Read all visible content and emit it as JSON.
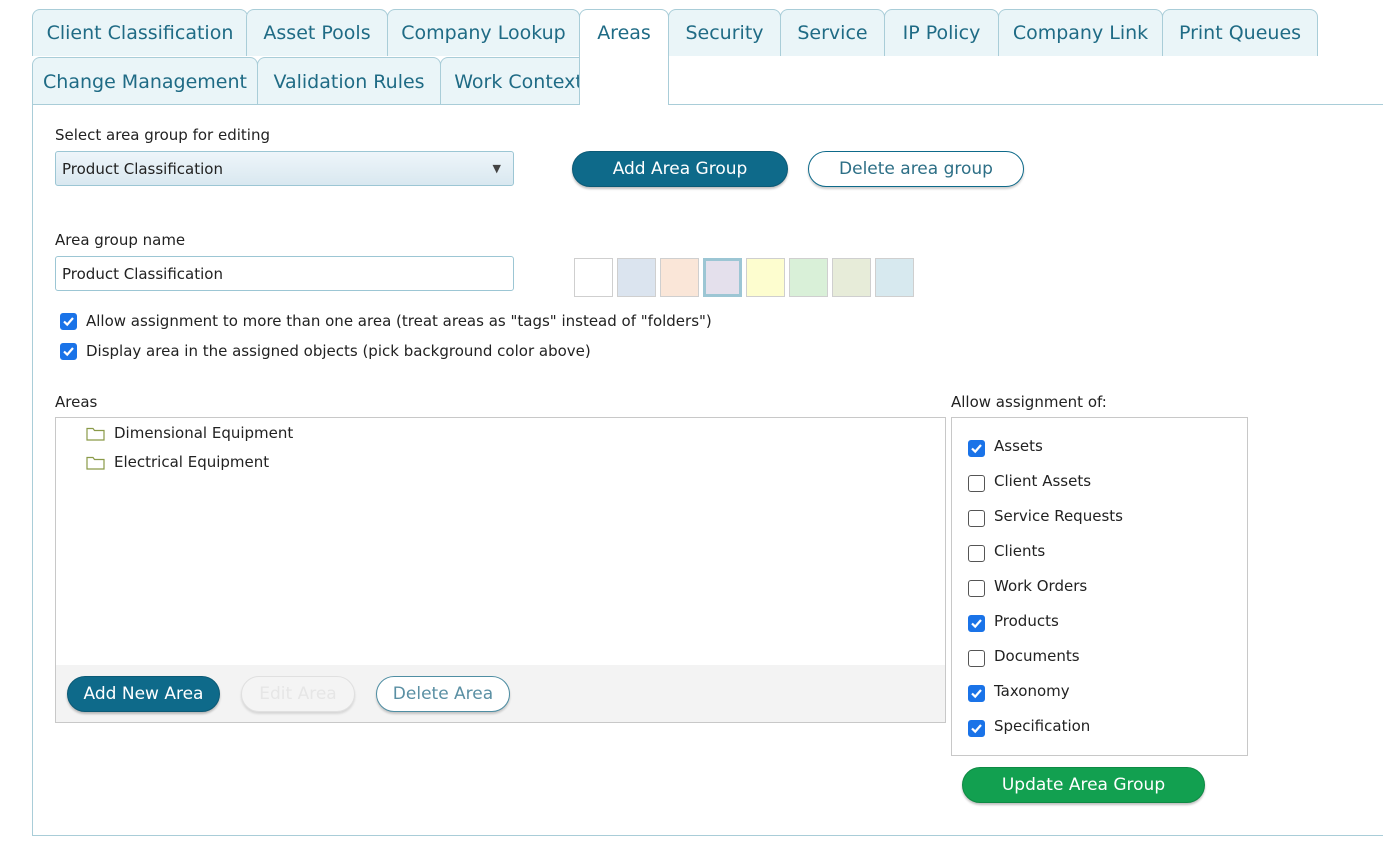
{
  "tabs": {
    "row1": [
      {
        "label": "Client Classification"
      },
      {
        "label": "Asset Pools"
      },
      {
        "label": "Company Lookup"
      },
      {
        "label": "Areas"
      },
      {
        "label": "Security"
      },
      {
        "label": "Service"
      },
      {
        "label": "IP Policy"
      },
      {
        "label": "Company Link"
      },
      {
        "label": "Print Queues"
      }
    ],
    "row2": [
      {
        "label": "Change Management"
      },
      {
        "label": "Validation Rules"
      },
      {
        "label": "Work Contexts"
      }
    ],
    "active": "Areas"
  },
  "group_select": {
    "label": "Select area group for editing",
    "value": "Product Classification"
  },
  "buttons": {
    "add_group": "Add Area Group",
    "delete_group": "Delete area group",
    "add_area": "Add New Area",
    "edit_area": "Edit Area",
    "delete_area": "Delete Area",
    "update_group": "Update Area Group"
  },
  "group_name": {
    "label": "Area group name",
    "value": "Product Classification"
  },
  "swatches": [
    {
      "color": "#ffffff",
      "selected": false
    },
    {
      "color": "#dbe4ef",
      "selected": false
    },
    {
      "color": "#fae6d8",
      "selected": false
    },
    {
      "color": "#e4e0ec",
      "selected": true
    },
    {
      "color": "#fdfdcf",
      "selected": false
    },
    {
      "color": "#d9f0d8",
      "selected": false
    },
    {
      "color": "#e7ecd9",
      "selected": false
    },
    {
      "color": "#d7e9ef",
      "selected": false
    }
  ],
  "options": {
    "multi_assign": {
      "label": "Allow assignment to more than one area (treat areas as \"tags\" instead of \"folders\")",
      "checked": true
    },
    "display_area": {
      "label": "Display area in the assigned objects (pick background color above)",
      "checked": true
    }
  },
  "areas": {
    "label": "Areas",
    "items": [
      {
        "name": "Dimensional Equipment",
        "icon": "folder-icon"
      },
      {
        "name": "Electrical Equipment",
        "icon": "folder-icon"
      }
    ]
  },
  "assignment": {
    "label": "Allow assignment of:",
    "items": [
      {
        "name": "Assets",
        "checked": true
      },
      {
        "name": "Client Assets",
        "checked": false
      },
      {
        "name": "Service Requests",
        "checked": false
      },
      {
        "name": "Clients",
        "checked": false
      },
      {
        "name": "Work Orders",
        "checked": false
      },
      {
        "name": "Products",
        "checked": true
      },
      {
        "name": "Documents",
        "checked": false
      },
      {
        "name": "Taxonomy",
        "checked": true
      },
      {
        "name": "Specification",
        "checked": true
      }
    ]
  },
  "colors": {
    "accent": "#0e6a8a",
    "tab_text": "#1f6b85",
    "checkbox": "#1a73e8",
    "update_button": "#12a050"
  }
}
